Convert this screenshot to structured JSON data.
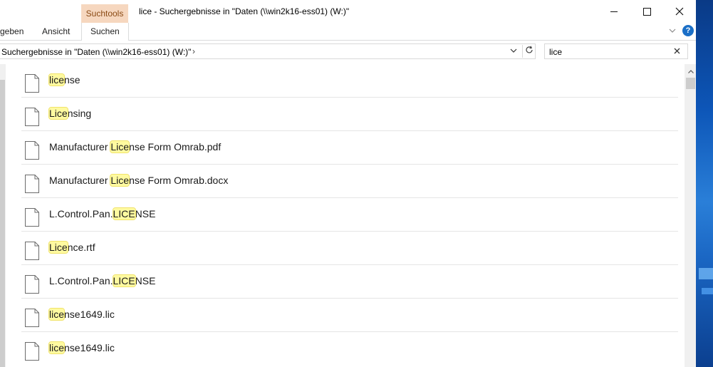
{
  "window": {
    "title": "lice - Suchergebnisse in \"Daten (\\\\win2k16-ess01) (W:)\"",
    "context_tab_group": "Suchtools"
  },
  "ribbon": {
    "tabs": [
      {
        "label": "geben"
      },
      {
        "label": "Ansicht"
      },
      {
        "label": "Suchen"
      }
    ],
    "active_tab": "Suchen",
    "help_label": "?"
  },
  "address": {
    "path": "Suchergebnisse in \"Daten (\\\\win2k16-ess01) (W:)\"",
    "chevron": "›"
  },
  "search": {
    "value": "lice",
    "placeholder": ""
  },
  "results": [
    {
      "pre": "",
      "match": "lice",
      "post": "nse"
    },
    {
      "pre": "",
      "match": "Lice",
      "post": "nsing"
    },
    {
      "pre": "Manufacturer ",
      "match": "Lice",
      "post": "nse Form Omrab.pdf"
    },
    {
      "pre": "Manufacturer ",
      "match": "Lice",
      "post": "nse Form Omrab.docx"
    },
    {
      "pre": "L.Control.Pan.",
      "match": "LICE",
      "post": "NSE"
    },
    {
      "pre": "",
      "match": "Lice",
      "post": "nce.rtf"
    },
    {
      "pre": "L.Control.Pan.",
      "match": "LICE",
      "post": "NSE"
    },
    {
      "pre": "",
      "match": "lice",
      "post": "nse1649.lic"
    },
    {
      "pre": "",
      "match": "lice",
      "post": "nse1649.lic"
    }
  ],
  "colors": {
    "context_tab": "#f6d7bf",
    "highlight": "#fffaa0",
    "help": "#1a6fc7"
  },
  "icons": {
    "file": "document-icon",
    "close": "close-icon",
    "maximize": "maximize-icon",
    "minimize": "minimize-icon",
    "refresh": "refresh-icon",
    "dropdown": "chevron-down-icon",
    "help": "help-icon"
  }
}
